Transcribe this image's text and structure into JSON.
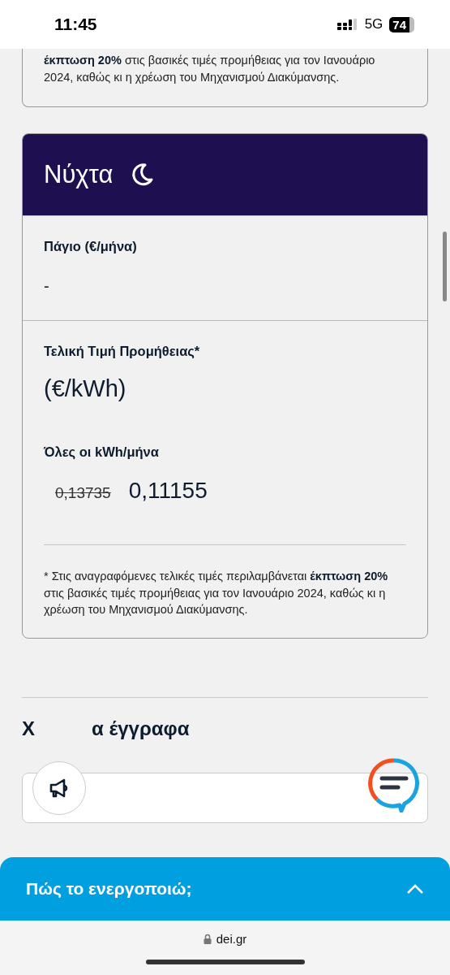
{
  "status_bar": {
    "time": "11:45",
    "network": "5G",
    "battery": "74"
  },
  "top_card": {
    "note": "**έκπτωση 20%** στις βασικές τιμές προμήθειας για τον Ιανουάριο 2024, καθώς κι η χρέωση του Μηχανισμού Διακύμανσης."
  },
  "night_card": {
    "title": "Νύχτα",
    "fixed_charge": {
      "label": "Πάγιο (€/μήνα)",
      "value": "-"
    },
    "final_price": {
      "label": "Τελική Τιμή Προμήθειας*",
      "unit": "(€/kWh)",
      "tiers": [
        {
          "label": "Όλες οι kWh/μήνα",
          "old_price": "0,13735",
          "price": "0,11155"
        }
      ]
    },
    "note": "* Στις αναγραφόμενες τελικές τιμές περιλαμβάνεται **έκπτωση 20%** στις βασικές τιμές προμήθειας για τον Ιανουάριο 2024, καθώς κι η χρέωση του Μηχανισμού Διακύμανσης."
  },
  "documents_heading": {
    "parts": [
      "Χ",
      "α έγγραφα"
    ]
  },
  "bottom_sheet": {
    "title": "Πώς το ενεργοποιώ;"
  },
  "browser_bar": {
    "url": "dei.gr"
  }
}
